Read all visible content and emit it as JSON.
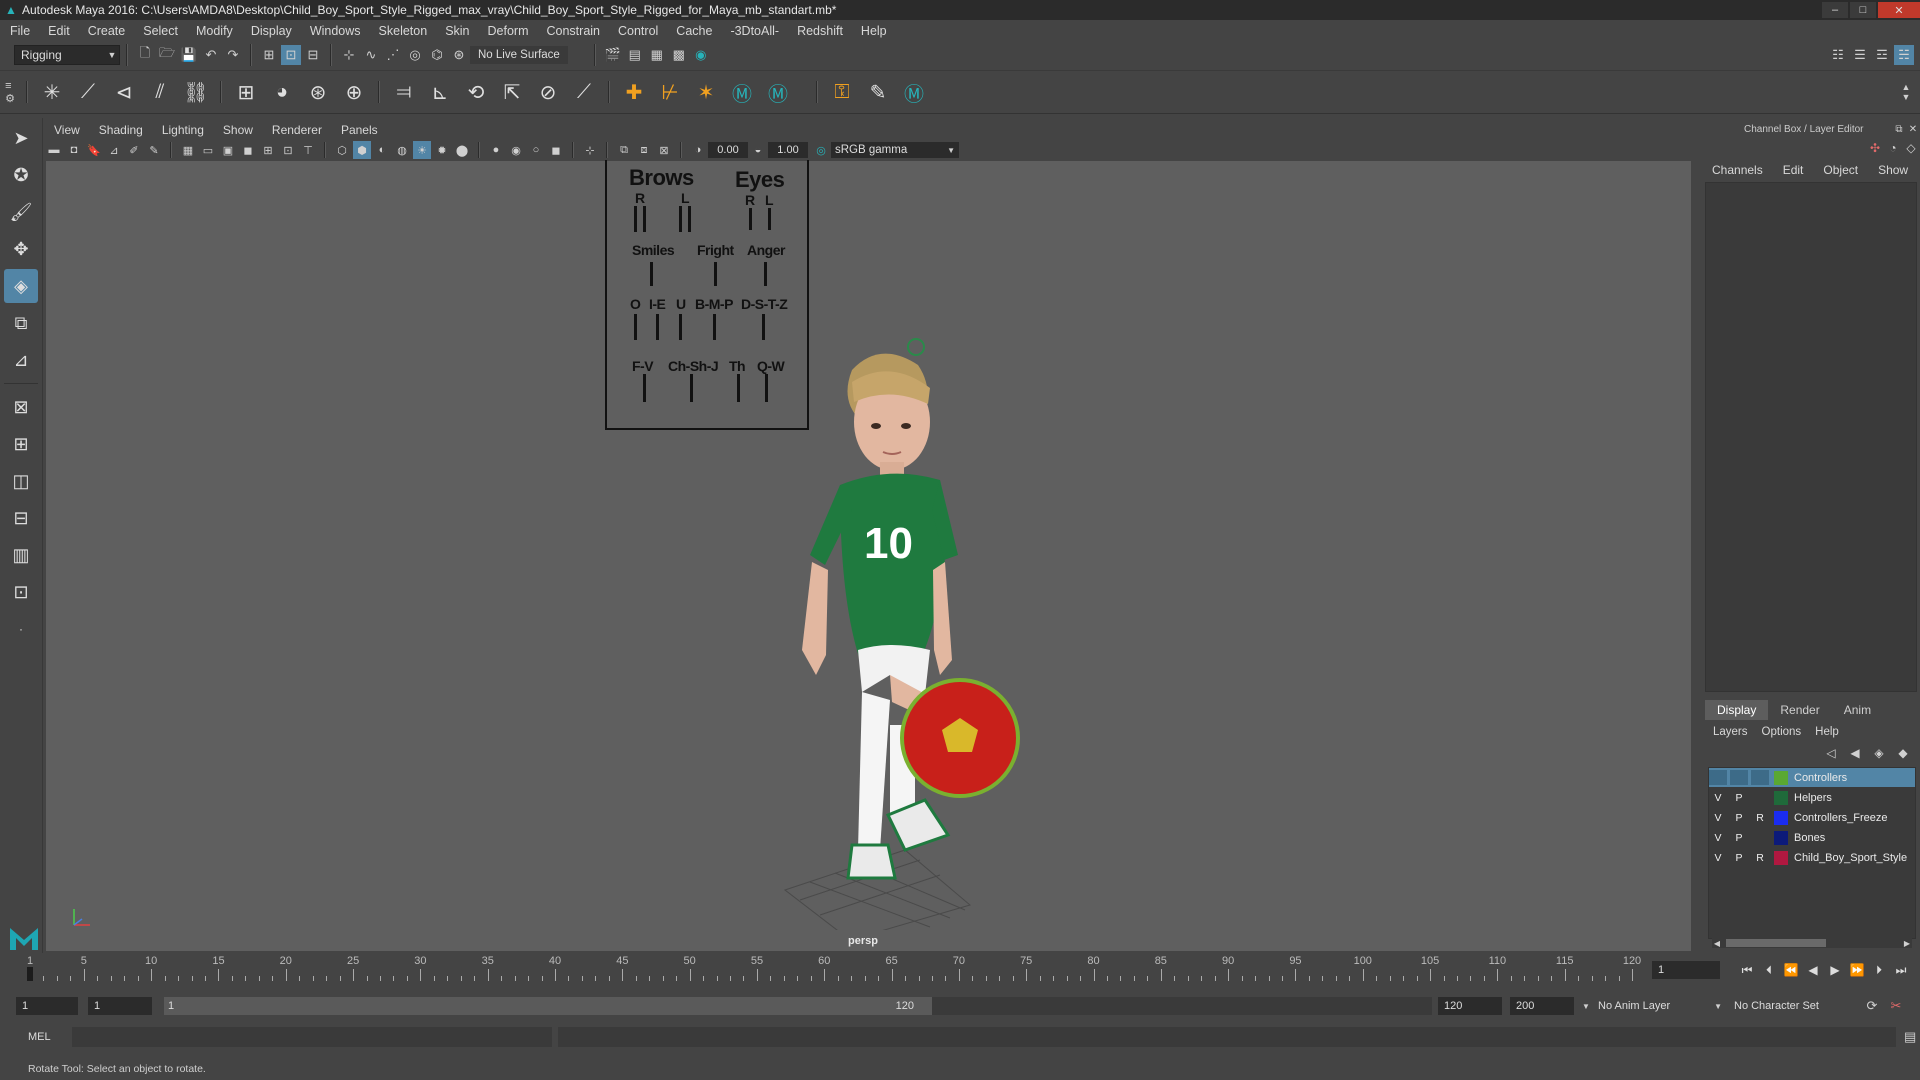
{
  "window": {
    "title": "Autodesk Maya 2016: C:\\Users\\AMDA8\\Desktop\\Child_Boy_Sport_Style_Rigged_max_vray\\Child_Boy_Sport_Style_Rigged_for_Maya_mb_standart.mb*",
    "controls": {
      "minimize": "–",
      "maximize": "□",
      "close": "✕"
    }
  },
  "menubar": [
    "File",
    "Edit",
    "Create",
    "Select",
    "Modify",
    "Display",
    "Windows",
    "Skeleton",
    "Skin",
    "Deform",
    "Constrain",
    "Control",
    "Cache",
    "-3DtoAll-",
    "Redshift",
    "Help"
  ],
  "statusline": {
    "mode": "Rigging",
    "live_surface": "No Live Surface"
  },
  "viewport": {
    "menus": [
      "View",
      "Shading",
      "Lighting",
      "Show",
      "Renderer",
      "Panels"
    ],
    "exposure": "0.00",
    "gamma": "1.00",
    "color_space": "sRGB gamma",
    "camera": "persp"
  },
  "face_board": {
    "brows": "Brows",
    "eyes": "Eyes",
    "brows_r": "R",
    "brows_l": "L",
    "eyes_r": "R",
    "eyes_l": "L",
    "smiles": "Smiles",
    "fright": "Fright",
    "anger": "Anger",
    "o": "O",
    "ie": "I-E",
    "u": "U",
    "bmp": "B-M-P",
    "dstz": "D-S-T-Z",
    "fv": "F-V",
    "chshj": "Ch-Sh-J",
    "th": "Th",
    "qw": "Q-W"
  },
  "character": {
    "jersey_number": "10",
    "jersey_color": "#1f7a3f",
    "ball_color": "#c8201a"
  },
  "channel_box": {
    "title": "Channel Box / Layer Editor",
    "menus": [
      "Channels",
      "Edit",
      "Object",
      "Show"
    ]
  },
  "layer_editor": {
    "tabs": [
      "Display",
      "Render",
      "Anim"
    ],
    "active_tab": "Display",
    "menus": [
      "Layers",
      "Options",
      "Help"
    ],
    "layers": [
      {
        "v": "",
        "p": "",
        "r": "",
        "name": "Controllers",
        "color": "#5aa832",
        "selected": true
      },
      {
        "v": "V",
        "p": "P",
        "r": "",
        "name": "Helpers",
        "color": "#1f6a3a",
        "selected": false
      },
      {
        "v": "V",
        "p": "P",
        "r": "R",
        "name": "Controllers_Freeze",
        "color": "#1a2cf0",
        "selected": false
      },
      {
        "v": "V",
        "p": "P",
        "r": "",
        "name": "Bones",
        "color": "#0c1a7a",
        "selected": false
      },
      {
        "v": "V",
        "p": "P",
        "r": "R",
        "name": "Child_Boy_Sport_Style",
        "color": "#b01840",
        "selected": false
      }
    ]
  },
  "timeslider": {
    "labels": [
      "1",
      "5",
      "10",
      "15",
      "20",
      "25",
      "30",
      "35",
      "40",
      "45",
      "50",
      "55",
      "60",
      "65",
      "70",
      "75",
      "80",
      "85",
      "90",
      "95",
      "100",
      "105",
      "110",
      "115",
      "120"
    ],
    "current_frame": "1"
  },
  "range": {
    "start": "1",
    "playback_start": "1",
    "slider_start": "1",
    "slider_end": "120",
    "playback_end": "120",
    "end": "200",
    "anim_layer": "No Anim Layer",
    "character_set": "No Character Set"
  },
  "commandline": {
    "language": "MEL"
  },
  "status": {
    "help_line": "Rotate Tool: Select an object to rotate."
  }
}
